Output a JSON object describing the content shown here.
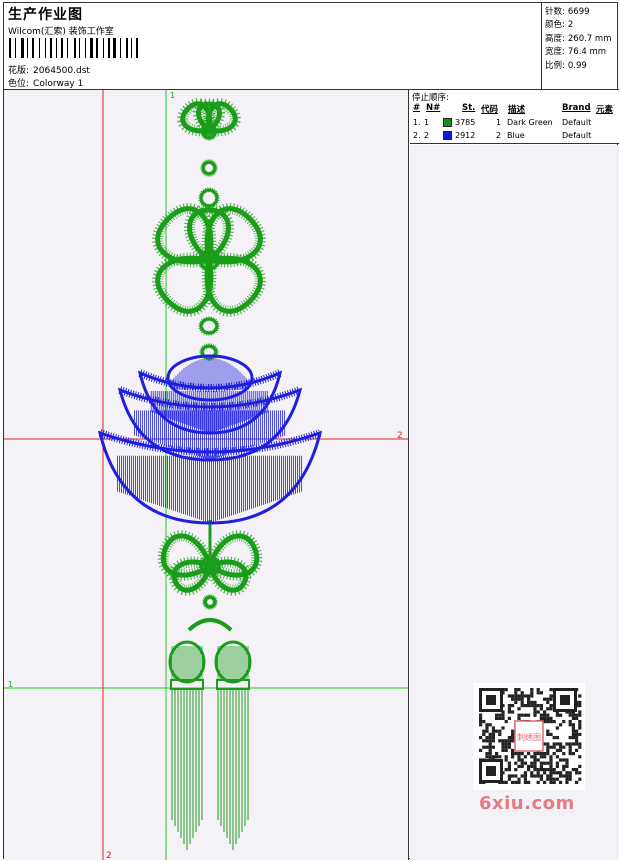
{
  "header": {
    "title": "生产作业图",
    "subtitle": "Wilcom(汇索) 装饰工作室",
    "design_label": "花版:",
    "design_value": "2064500.dst",
    "colorway_label": "色位:",
    "colorway_value": "Colorway 1"
  },
  "stats": [
    {
      "label": "针数:",
      "value": "6699"
    },
    {
      "label": "颜色:",
      "value": "2"
    },
    {
      "label": "高度:",
      "value": "260.7 mm"
    },
    {
      "label": "宽度:",
      "value": "76.4 mm"
    },
    {
      "label": "比例:",
      "value": "0.99"
    }
  ],
  "sequence": {
    "title": "停止顺序:",
    "headers": [
      "#",
      "N#",
      "St.",
      "代码",
      "描述",
      "Brand",
      "元素"
    ],
    "rows": [
      {
        "num": "1.",
        "n": "1",
        "color": "#1a8c1a",
        "st": "3785",
        "code": "1",
        "desc": "Dark Green",
        "brand": "Default"
      },
      {
        "num": "2.",
        "n": "2",
        "color": "#1717d9",
        "st": "2912",
        "code": "2",
        "desc": "Blue",
        "brand": "Default"
      }
    ]
  },
  "canvas": {
    "marker_1_top": "1",
    "marker_2_right": "2",
    "marker_1_left": "1",
    "marker_2_bottom": "2",
    "green": "#1a9e1a",
    "blue": "#1f1fe0",
    "red": "#e02020",
    "guide_green": "#22cc22"
  },
  "watermark": {
    "logo": "6xiu.com",
    "stamp": "刺绣图"
  }
}
